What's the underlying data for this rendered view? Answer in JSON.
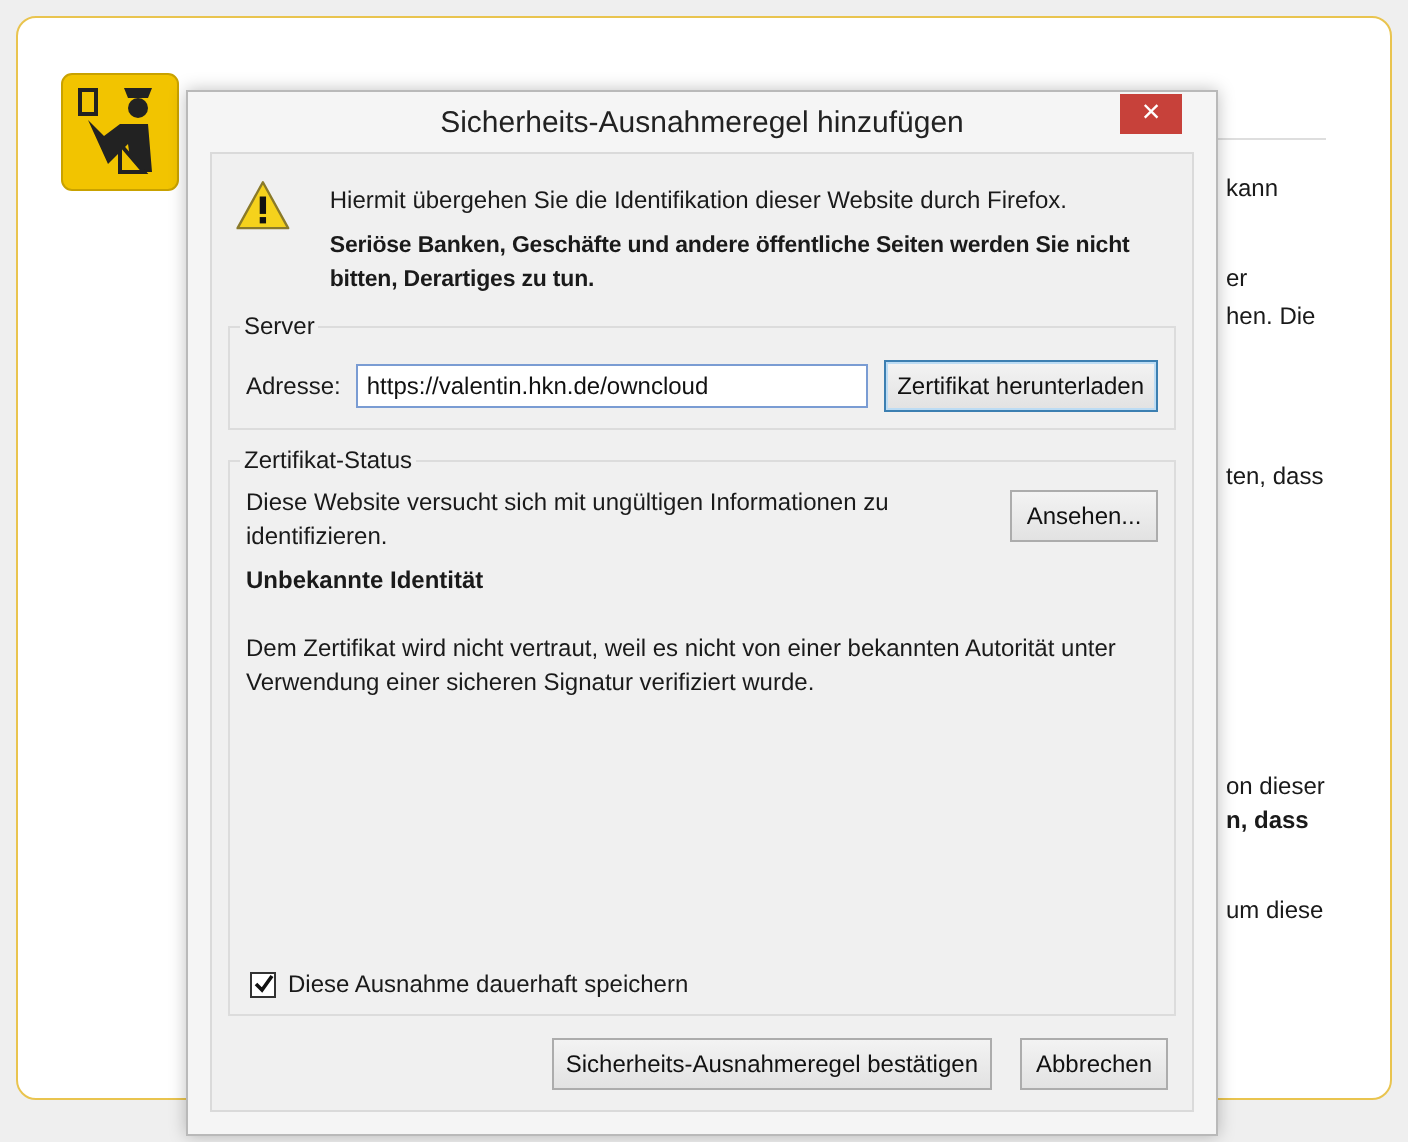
{
  "background_page": {
    "fragments": [
      {
        "text": "kann",
        "bold": false
      },
      {
        "text": "er",
        "bold": false
      },
      {
        "text": "hen. Die",
        "bold": false
      },
      {
        "text": "ten, dass",
        "bold": false
      },
      {
        "text": "on dieser",
        "bold": false
      },
      {
        "text": "n, dass",
        "bold": true
      },
      {
        "text": "um diese",
        "bold": false
      }
    ]
  },
  "dialog": {
    "title": "Sicherheits-Ausnahmeregel hinzufügen",
    "close_button": "×",
    "warning": {
      "text": "Hiermit übergehen Sie die Identifikation dieser Website durch Firefox.",
      "bold_text": "Seriöse Banken, Geschäfte und andere öffentliche Seiten werden Sie nicht bitten, Derartiges zu tun."
    },
    "server": {
      "legend": "Server",
      "address_label": "Adresse:",
      "address_value": "https://valentin.hkn.de/owncloud",
      "download_button": "Zertifikat herunterladen"
    },
    "certificate_status": {
      "legend": "Zertifikat-Status",
      "message": "Diese Website versucht sich mit ungültigen Informationen zu identifizieren.",
      "view_button": "Ansehen...",
      "heading": "Unbekannte Identität",
      "detail": "Dem Zertifikat wird nicht vertraut, weil es nicht von einer bekannten Autorität unter Verwendung einer sicheren Signatur verifiziert wurde.",
      "permanent": {
        "label": "Diese Ausnahme dauerhaft speichern",
        "checked": true
      }
    },
    "buttons": [
      {
        "label": "Sicherheits-Ausnahmeregel bestätigen"
      },
      {
        "label": "Abbrechen"
      }
    ]
  }
}
